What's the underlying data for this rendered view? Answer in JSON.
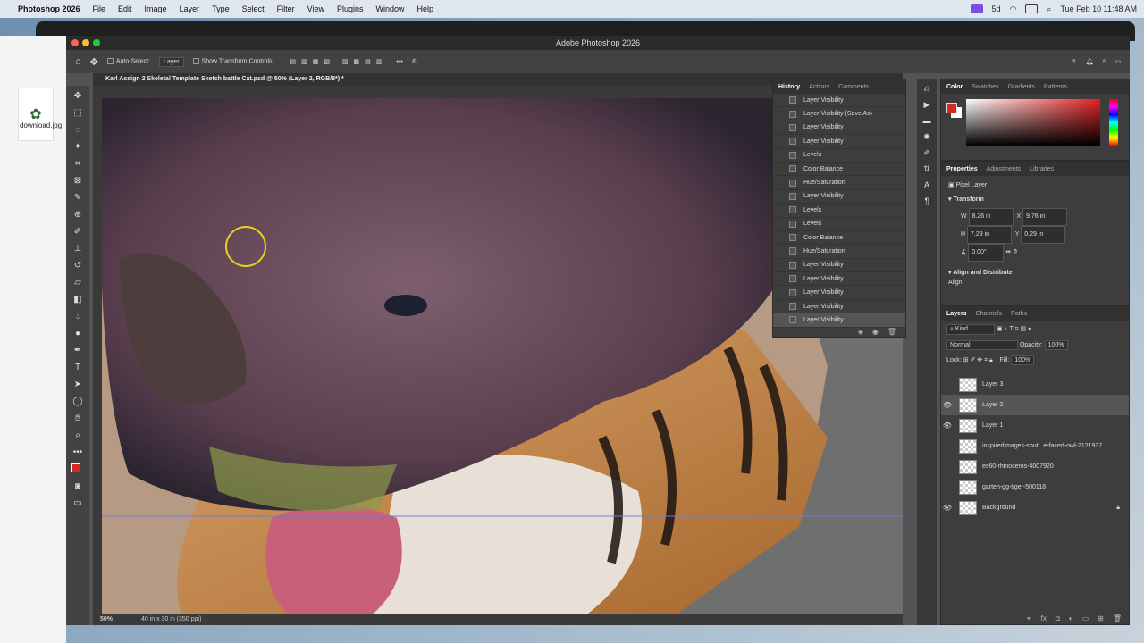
{
  "menubar": {
    "apple": "",
    "app_name": "Photoshop 2026",
    "items": [
      "File",
      "Edit",
      "Image",
      "Layer",
      "Type",
      "Select",
      "Filter",
      "View",
      "Plugins",
      "Window",
      "Help"
    ],
    "status_text": "5d",
    "clock": "Tue Feb 10  11:48 AM"
  },
  "browser": {
    "download_label": "download.jpg"
  },
  "window": {
    "title": "Adobe Photoshop 2026"
  },
  "options_bar": {
    "auto_select_label": "Auto-Select:",
    "auto_select_value": "Layer",
    "show_transform_label": "Show Transform Controls"
  },
  "document": {
    "tab_title": "Karl Assign 2 Skeletal Template Sketch battle Cat.psd @ 50% (Layer 2, RGB/8*) *",
    "zoom": "50%",
    "doc_info": "40 in x 30 in (350 ppi)"
  },
  "history": {
    "tabs": [
      "History",
      "Actions",
      "Comments"
    ],
    "items": [
      "Layer Visibility",
      "Layer Visibility (Save As)",
      "Layer Visibility",
      "Layer Visibility",
      "Levels",
      "Color Balance",
      "Hue/Saturation",
      "Layer Visibility",
      "Levels",
      "Levels",
      "Color Balance",
      "Hue/Saturation",
      "Layer Visibility",
      "Layer Visibility",
      "Layer Visibility",
      "Layer Visibility",
      "Layer Visibility"
    ]
  },
  "color_panel": {
    "tabs": [
      "Color",
      "Swatches",
      "Gradients",
      "Patterns"
    ],
    "foreground": "#d42a22",
    "background": "#ffffff"
  },
  "properties": {
    "tabs": [
      "Properties",
      "Adjustments",
      "Libraries"
    ],
    "kind": "Pixel Layer",
    "transform_label": "Transform",
    "w_label": "W",
    "w": "8.26 in",
    "x_label": "X",
    "x": "9.76 in",
    "h_label": "H",
    "h": "7.29 in",
    "y_label": "Y",
    "y": "0.29 in",
    "angle": "0.00°",
    "align_label": "Align and Distribute",
    "align_sub": "Align:"
  },
  "layers_panel": {
    "tabs": [
      "Layers",
      "Channels",
      "Paths"
    ],
    "kind": "Kind",
    "blend_mode": "Normal",
    "opacity_label": "Opacity:",
    "opacity": "100%",
    "lock_label": "Lock:",
    "fill_label": "Fill:",
    "fill": "100%",
    "layers": [
      {
        "name": "Layer 3",
        "visible": false
      },
      {
        "name": "Layer 2",
        "visible": true
      },
      {
        "name": "Layer 1",
        "visible": true
      },
      {
        "name": "inspiredimages-sout...e-faced-owl-2121937",
        "visible": false
      },
      {
        "name": "es60-rhinoceros-4007920",
        "visible": false
      },
      {
        "name": "garten-gg-tiger-500118",
        "visible": false
      },
      {
        "name": "Background",
        "visible": true
      }
    ]
  }
}
